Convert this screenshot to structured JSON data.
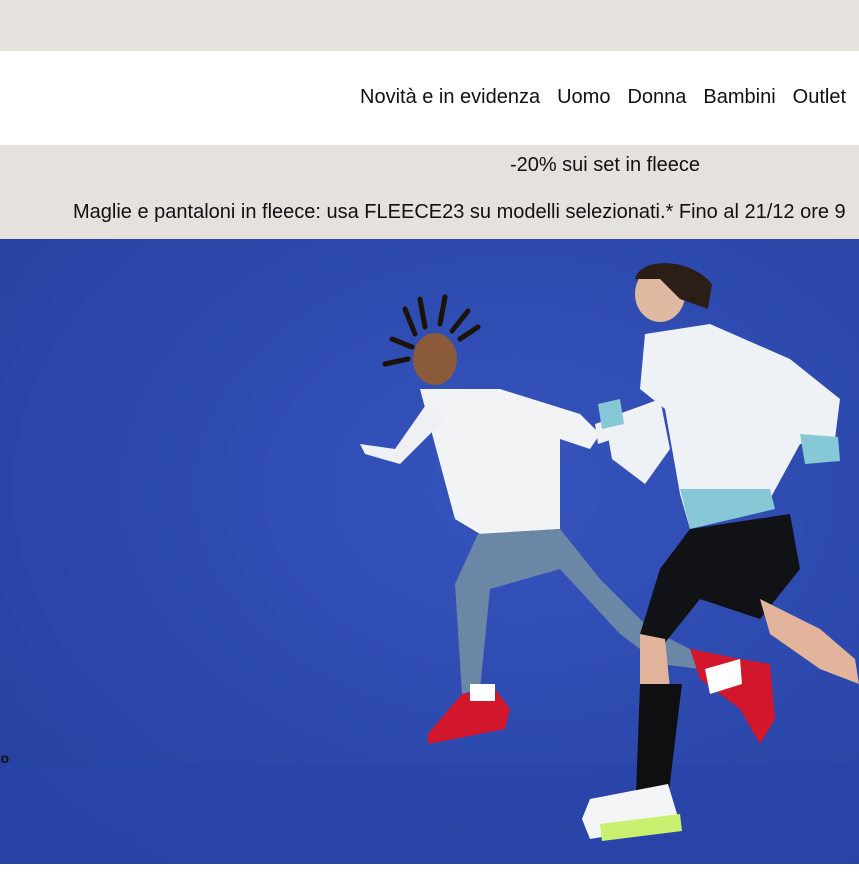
{
  "nav": {
    "items": [
      {
        "label": "Novità e in evidenza"
      },
      {
        "label": "Uomo"
      },
      {
        "label": "Donna"
      },
      {
        "label": "Bambini"
      },
      {
        "label": "Outlet"
      }
    ]
  },
  "promo": {
    "title": "-20% sui set in fleece",
    "description": "Maglie e pantaloni in fleece: usa FLEECE23 su modelli selezionati.* Fino al 21/12 ore 9"
  },
  "hero": {
    "caption": "to",
    "background_color": "#2a44a4",
    "image_description": "hero-runners-image"
  },
  "colors": {
    "strip": "#e5e2dd",
    "text": "#111111",
    "hero_blue": "#2a44a4"
  }
}
